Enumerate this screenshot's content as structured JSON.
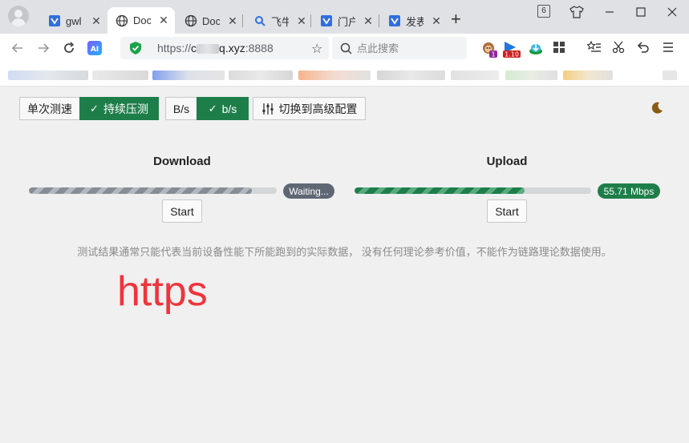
{
  "browser": {
    "tabs": [
      {
        "label": "gwl",
        "icon": "blue-tag-icon",
        "active": false
      },
      {
        "label": "Doc",
        "icon": "globe-icon",
        "active": true
      },
      {
        "label": "Doc",
        "icon": "globe-icon",
        "active": false
      },
      {
        "label": "飞牛",
        "icon": "search-icon",
        "active": false
      },
      {
        "label": "门户",
        "icon": "blue-tag-icon",
        "active": false
      },
      {
        "label": "发表",
        "icon": "blue-tag-icon",
        "active": false
      }
    ],
    "tab_count_badge": "6",
    "address": {
      "scheme": "https://",
      "host_prefix": "c",
      "host_suffix": "q.xyz",
      "port": ":8888"
    },
    "search_placeholder": "点此搜索",
    "extension_badges": {
      "first": "1",
      "second": "1.10"
    },
    "ai_label": "AI"
  },
  "controls": {
    "mode_single": "单次测速",
    "mode_continuous": "持续压测",
    "unit_bytes": "B/s",
    "unit_bits": "b/s",
    "advanced": "切换到高级配置"
  },
  "download": {
    "title": "Download",
    "status": "Waiting...",
    "progress": 0.9,
    "start_label": "Start"
  },
  "upload": {
    "title": "Upload",
    "status": "55.71 Mbps",
    "progress": 0.72,
    "start_label": "Start"
  },
  "notice": "测试结果通常只能代表当前设备性能下所能跑到的实际数据， 没有任何理论参考价值，不能作为链路理论数据使用。",
  "annotation": "https",
  "colors": {
    "accent_green": "#1e7e4a",
    "annotation_red": "#f0343c",
    "waiting_gray": "#5f6775"
  }
}
